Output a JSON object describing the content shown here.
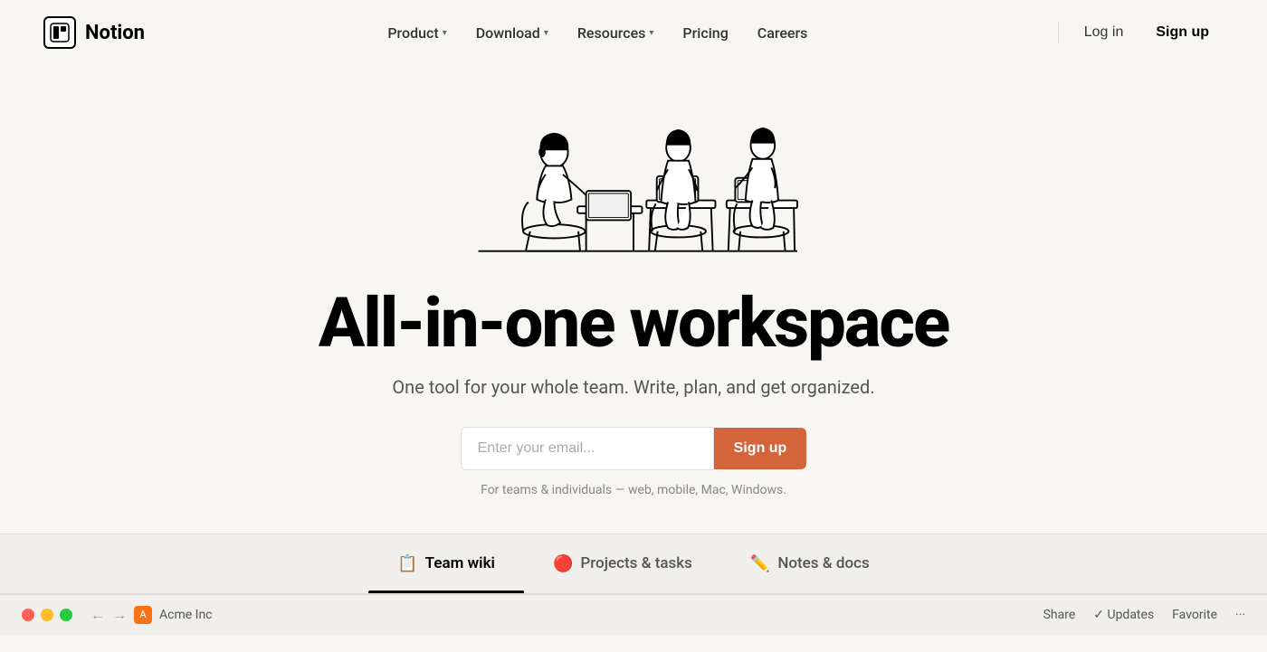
{
  "brand": {
    "logo_text": "Notion",
    "logo_icon": "N"
  },
  "nav": {
    "items": [
      {
        "label": "Product",
        "has_dropdown": true
      },
      {
        "label": "Download",
        "has_dropdown": true
      },
      {
        "label": "Resources",
        "has_dropdown": true
      },
      {
        "label": "Pricing",
        "has_dropdown": false
      },
      {
        "label": "Careers",
        "has_dropdown": false
      }
    ],
    "login_label": "Log in",
    "signup_label": "Sign up"
  },
  "hero": {
    "title": "All-in-one workspace",
    "subtitle": "One tool for your whole team. Write, plan, and get organized.",
    "email_placeholder": "Enter your email...",
    "signup_button": "Sign up",
    "disclaimer": "For teams & individuals — web, mobile, Mac, Windows."
  },
  "tabs": [
    {
      "label": "Team wiki",
      "icon": "📋",
      "active": true
    },
    {
      "label": "Projects & tasks",
      "icon": "🔴",
      "active": false
    },
    {
      "label": "Notes & docs",
      "icon": "✏️",
      "active": false
    }
  ],
  "browser_chrome": {
    "breadcrumb_company": "Acme Inc",
    "actions": [
      "Share",
      "✓ Updates",
      "Favorite",
      "···"
    ]
  }
}
